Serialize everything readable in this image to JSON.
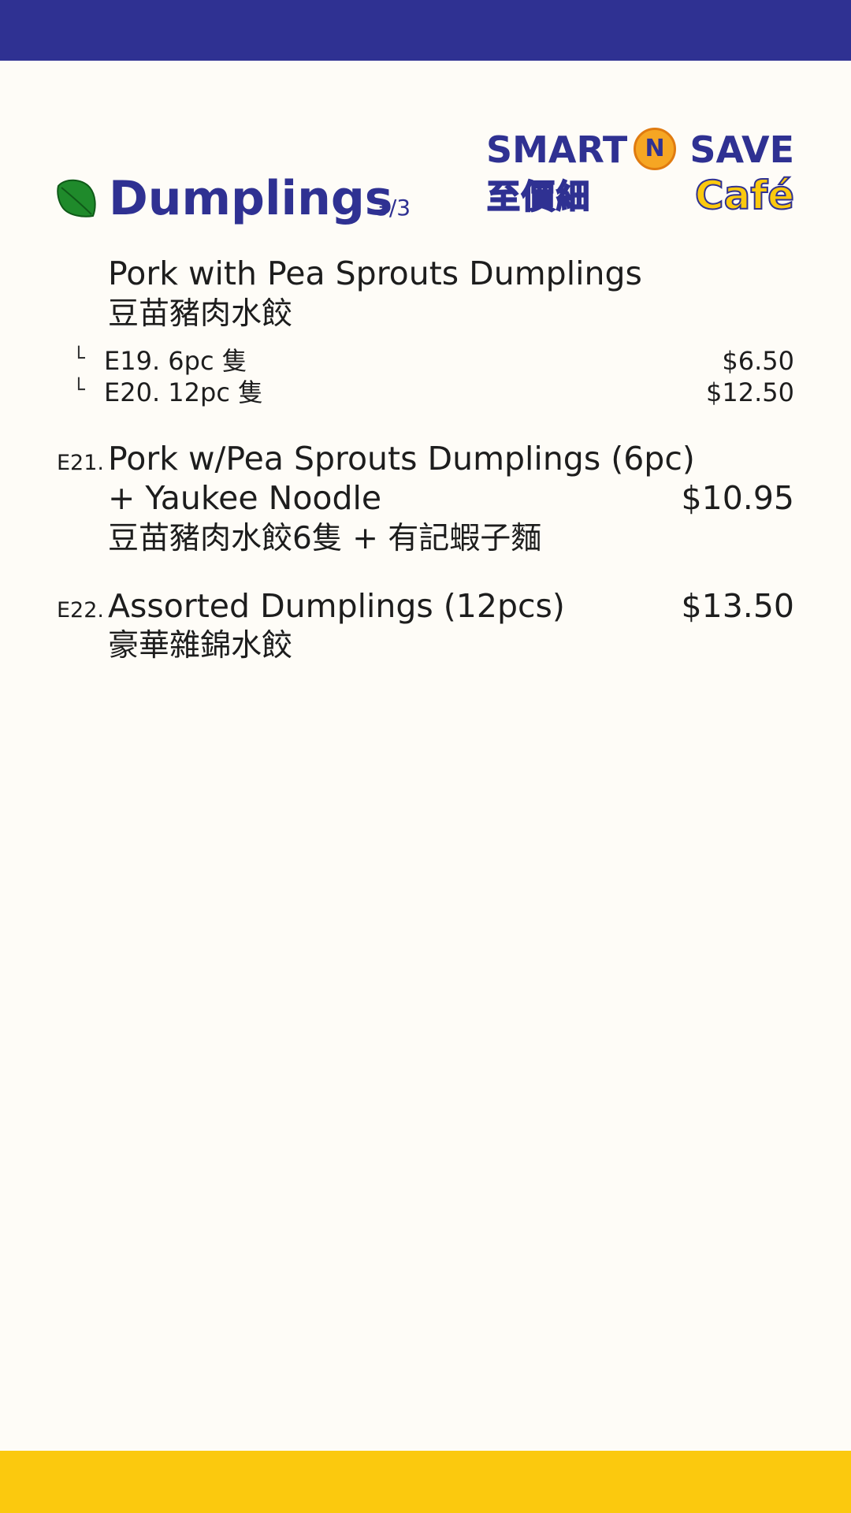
{
  "colors": {
    "primary_blue": "#2f3192",
    "accent_yellow": "#fbc90e",
    "leaf_green": "#1f8a2b",
    "background": "#fefcf7"
  },
  "logo": {
    "word_left": "SMART",
    "badge_letter": "N",
    "word_right": "SAVE",
    "chinese": "至價細",
    "cafe": "Café"
  },
  "section": {
    "icon": "leaf-icon",
    "title": "Dumplings",
    "page": "3/3"
  },
  "items": [
    {
      "name": "Pork with Pea Sprouts Dumplings",
      "name_zh": "豆苗豬肉水餃",
      "options": [
        {
          "label": "E19. 6pc 隻",
          "price": "$6.50"
        },
        {
          "label": "E20. 12pc 隻",
          "price": "$12.50"
        }
      ]
    },
    {
      "code": "E21.",
      "name_line1": "Pork w/Pea Sprouts Dumplings (6pc)",
      "name_line2": "+ Yaukee Noodle",
      "name_zh": "豆苗豬肉水餃6隻 + 有記蝦子麵",
      "price": "$10.95"
    },
    {
      "code": "E22.",
      "name": "Assorted Dumplings (12pcs)",
      "name_zh": "豪華雜錦水餃",
      "price": "$13.50"
    }
  ]
}
